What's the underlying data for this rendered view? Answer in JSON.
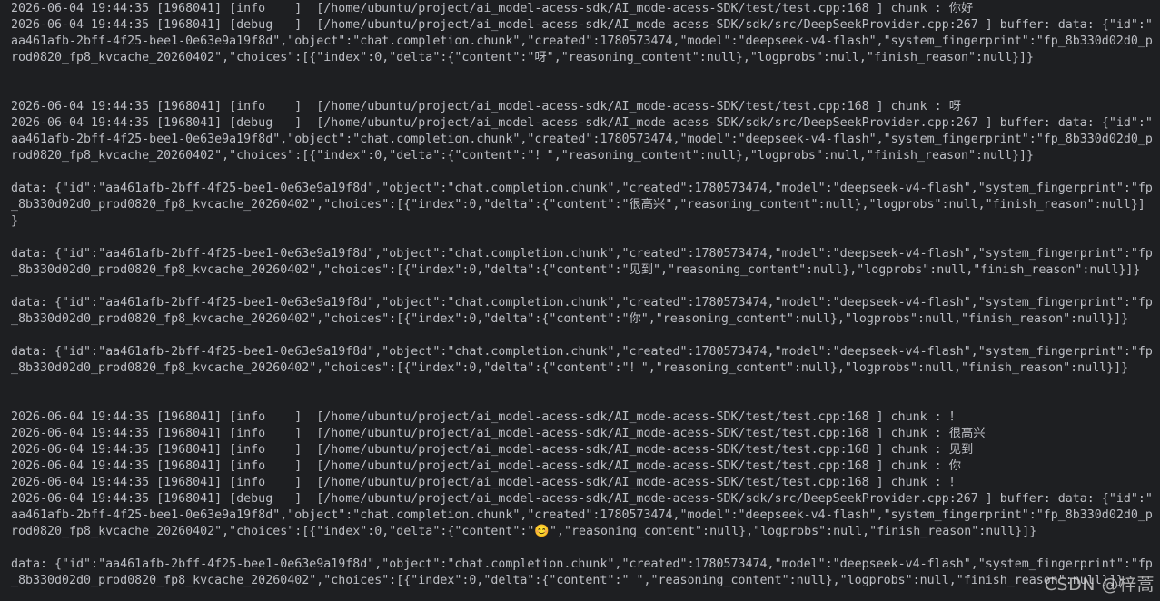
{
  "terminal": {
    "lines": [
      "2026-06-04 19:44:35 [1968041] [info    ]  [/home/ubuntu/project/ai_model-acess-sdk/AI_mode-acess-SDK/test/test.cpp:168 ] chunk : 你好",
      "2026-06-04 19:44:35 [1968041] [debug   ]  [/home/ubuntu/project/ai_model-acess-sdk/AI_mode-acess-SDK/sdk/src/DeepSeekProvider.cpp:267 ] buffer: data: {\"id\":\"",
      "aa461afb-2bff-4f25-bee1-0e63e9a19f8d\",\"object\":\"chat.completion.chunk\",\"created\":1780573474,\"model\":\"deepseek-v4-flash\",\"system_fingerprint\":\"fp_8b330d02d0_p",
      "rod0820_fp8_kvcache_20260402\",\"choices\":[{\"index\":0,\"delta\":{\"content\":\"呀\",\"reasoning_content\":null},\"logprobs\":null,\"finish_reason\":null}]}",
      "",
      "",
      "2026-06-04 19:44:35 [1968041] [info    ]  [/home/ubuntu/project/ai_model-acess-sdk/AI_mode-acess-SDK/test/test.cpp:168 ] chunk : 呀",
      "2026-06-04 19:44:35 [1968041] [debug   ]  [/home/ubuntu/project/ai_model-acess-sdk/AI_mode-acess-SDK/sdk/src/DeepSeekProvider.cpp:267 ] buffer: data: {\"id\":\"",
      "aa461afb-2bff-4f25-bee1-0e63e9a19f8d\",\"object\":\"chat.completion.chunk\",\"created\":1780573474,\"model\":\"deepseek-v4-flash\",\"system_fingerprint\":\"fp_8b330d02d0_p",
      "rod0820_fp8_kvcache_20260402\",\"choices\":[{\"index\":0,\"delta\":{\"content\":\"！\",\"reasoning_content\":null},\"logprobs\":null,\"finish_reason\":null}]}",
      "",
      "data: {\"id\":\"aa461afb-2bff-4f25-bee1-0e63e9a19f8d\",\"object\":\"chat.completion.chunk\",\"created\":1780573474,\"model\":\"deepseek-v4-flash\",\"system_fingerprint\":\"fp",
      "_8b330d02d0_prod0820_fp8_kvcache_20260402\",\"choices\":[{\"index\":0,\"delta\":{\"content\":\"很高兴\",\"reasoning_content\":null},\"logprobs\":null,\"finish_reason\":null}]",
      "}",
      "",
      "data: {\"id\":\"aa461afb-2bff-4f25-bee1-0e63e9a19f8d\",\"object\":\"chat.completion.chunk\",\"created\":1780573474,\"model\":\"deepseek-v4-flash\",\"system_fingerprint\":\"fp",
      "_8b330d02d0_prod0820_fp8_kvcache_20260402\",\"choices\":[{\"index\":0,\"delta\":{\"content\":\"见到\",\"reasoning_content\":null},\"logprobs\":null,\"finish_reason\":null}]}",
      "",
      "data: {\"id\":\"aa461afb-2bff-4f25-bee1-0e63e9a19f8d\",\"object\":\"chat.completion.chunk\",\"created\":1780573474,\"model\":\"deepseek-v4-flash\",\"system_fingerprint\":\"fp",
      "_8b330d02d0_prod0820_fp8_kvcache_20260402\",\"choices\":[{\"index\":0,\"delta\":{\"content\":\"你\",\"reasoning_content\":null},\"logprobs\":null,\"finish_reason\":null}]}",
      "",
      "data: {\"id\":\"aa461afb-2bff-4f25-bee1-0e63e9a19f8d\",\"object\":\"chat.completion.chunk\",\"created\":1780573474,\"model\":\"deepseek-v4-flash\",\"system_fingerprint\":\"fp",
      "_8b330d02d0_prod0820_fp8_kvcache_20260402\",\"choices\":[{\"index\":0,\"delta\":{\"content\":\"！\",\"reasoning_content\":null},\"logprobs\":null,\"finish_reason\":null}]}",
      "",
      "",
      "2026-06-04 19:44:35 [1968041] [info    ]  [/home/ubuntu/project/ai_model-acess-sdk/AI_mode-acess-SDK/test/test.cpp:168 ] chunk : ！",
      "2026-06-04 19:44:35 [1968041] [info    ]  [/home/ubuntu/project/ai_model-acess-sdk/AI_mode-acess-SDK/test/test.cpp:168 ] chunk : 很高兴",
      "2026-06-04 19:44:35 [1968041] [info    ]  [/home/ubuntu/project/ai_model-acess-sdk/AI_mode-acess-SDK/test/test.cpp:168 ] chunk : 见到",
      "2026-06-04 19:44:35 [1968041] [info    ]  [/home/ubuntu/project/ai_model-acess-sdk/AI_mode-acess-SDK/test/test.cpp:168 ] chunk : 你",
      "2026-06-04 19:44:35 [1968041] [info    ]  [/home/ubuntu/project/ai_model-acess-sdk/AI_mode-acess-SDK/test/test.cpp:168 ] chunk : ！",
      "2026-06-04 19:44:35 [1968041] [debug   ]  [/home/ubuntu/project/ai_model-acess-sdk/AI_mode-acess-SDK/sdk/src/DeepSeekProvider.cpp:267 ] buffer: data: {\"id\":\"",
      "aa461afb-2bff-4f25-bee1-0e63e9a19f8d\",\"object\":\"chat.completion.chunk\",\"created\":1780573474,\"model\":\"deepseek-v4-flash\",\"system_fingerprint\":\"fp_8b330d02d0_p",
      "rod0820_fp8_kvcache_20260402\",\"choices\":[{\"index\":0,\"delta\":{\"content\":\"😊\",\"reasoning_content\":null},\"logprobs\":null,\"finish_reason\":null}]}",
      "",
      "data: {\"id\":\"aa461afb-2bff-4f25-bee1-0e63e9a19f8d\",\"object\":\"chat.completion.chunk\",\"created\":1780573474,\"model\":\"deepseek-v4-flash\",\"system_fingerprint\":\"fp",
      "_8b330d02d0_prod0820_fp8_kvcache_20260402\",\"choices\":[{\"index\":0,\"delta\":{\"content\":\" \",\"reasoning_content\":null},\"logprobs\":null,\"finish_reason\":null}]}"
    ]
  },
  "watermark": {
    "text": "CSDN @梓蒿"
  },
  "colors": {
    "background": "#1e1f22",
    "text": "#bcbec4"
  }
}
